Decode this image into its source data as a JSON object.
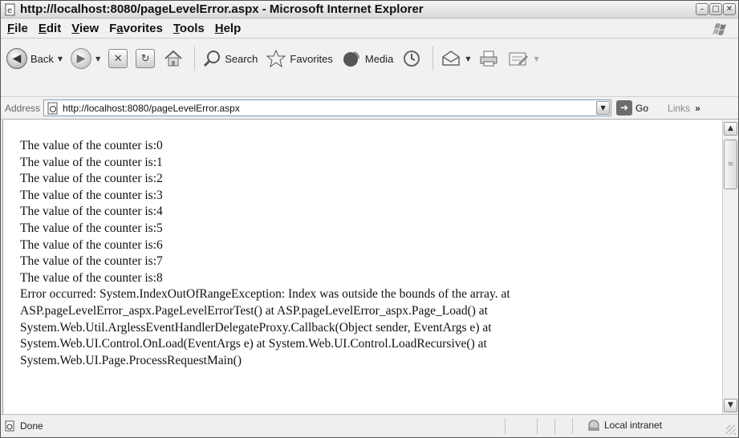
{
  "window": {
    "title": "http://localhost:8080/pageLevelError.aspx - Microsoft Internet Explorer"
  },
  "menu": [
    {
      "u": "F",
      "rest": "ile"
    },
    {
      "u": "E",
      "rest": "dit"
    },
    {
      "u": "V",
      "rest": "iew"
    },
    {
      "pre": "F",
      "u": "a",
      "rest": "vorites"
    },
    {
      "u": "T",
      "rest": "ools"
    },
    {
      "u": "H",
      "rest": "elp"
    }
  ],
  "toolbar": {
    "back_label": "Back",
    "search_label": "Search",
    "favorites_label": "Favorites",
    "media_label": "Media"
  },
  "address": {
    "label": "Address",
    "url": "http://localhost:8080/pageLevelError.aspx",
    "go_label": "Go",
    "links_label": "Links"
  },
  "content": {
    "lines": [
      "The value of the counter is:0",
      "The value of the counter is:1",
      "The value of the counter is:2",
      "The value of the counter is:3",
      "The value of the counter is:4",
      "The value of the counter is:5",
      "The value of the counter is:6",
      "The value of the counter is:7",
      "The value of the counter is:8",
      "Error occurred: System.IndexOutOfRangeException: Index was outside the bounds of the array. at",
      "ASP.pageLevelError_aspx.PageLevelErrorTest() at ASP.pageLevelError_aspx.Page_Load() at",
      "System.Web.Util.ArglessEventHandlerDelegateProxy.Callback(Object sender, EventArgs e) at",
      "System.Web.UI.Control.OnLoad(EventArgs e) at System.Web.UI.Control.LoadRecursive() at",
      "System.Web.UI.Page.ProcessRequestMain()"
    ]
  },
  "status": {
    "text": "Done",
    "zone": "Local intranet"
  }
}
